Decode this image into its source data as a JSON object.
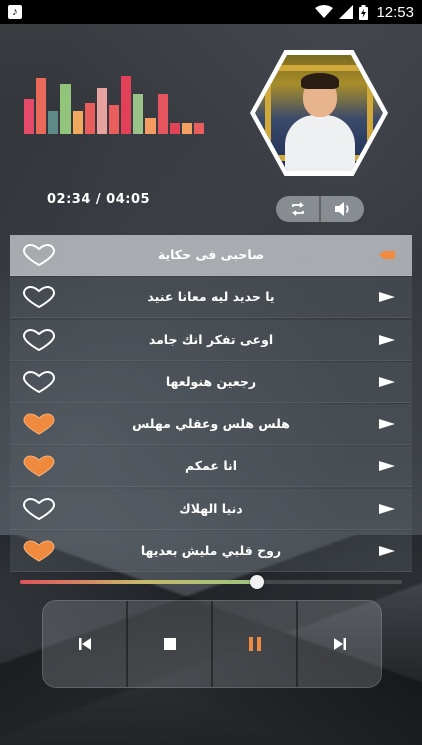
{
  "status_bar": {
    "time": "12:53",
    "icons": [
      "music-note-icon",
      "wifi-icon",
      "signal-icon",
      "battery-icon"
    ]
  },
  "equalizer": {
    "levels": [
      0.58,
      0.94,
      0.38,
      0.84,
      0.38,
      0.51,
      0.76,
      0.48,
      0.96,
      0.66,
      0.26,
      0.66,
      0.18,
      0.18,
      0.18
    ],
    "colors": [
      "#e64b6a",
      "#e96a5a",
      "#5e8a88",
      "#93c47b",
      "#f1a95e",
      "#e95d5d",
      "#e7a3a0",
      "#e95d5d",
      "#e23f59",
      "#9ac38a",
      "#f39b61",
      "#e55560",
      "#e04456",
      "#f3a163",
      "#e95d5d"
    ]
  },
  "player": {
    "time_display": "02:34 / 04:05",
    "progress": 0.62,
    "repeat_icon": "repeat-icon",
    "volume_icon": "volume-icon"
  },
  "playlist": [
    {
      "title": "صاحبى فى حكاية",
      "favorite": false,
      "active": true
    },
    {
      "title": "يا حديد ليه معانا عنيد",
      "favorite": false,
      "active": false
    },
    {
      "title": "اوعى تفكر انك جامد",
      "favorite": false,
      "active": false
    },
    {
      "title": "رجعين هنولعها",
      "favorite": false,
      "active": false
    },
    {
      "title": "هلس هلس وعقلي مهلس",
      "favorite": true,
      "active": false
    },
    {
      "title": "انا عمكم",
      "favorite": true,
      "active": false
    },
    {
      "title": "دنيا الهلاك",
      "favorite": false,
      "active": false
    },
    {
      "title": "روح قلبي مليش بعديها",
      "favorite": true,
      "active": false
    }
  ],
  "transport": {
    "buttons": [
      "previous-icon",
      "stop-icon",
      "pause-icon",
      "next-icon"
    ]
  },
  "colors": {
    "accent": "#f08a3e",
    "heart_filled": "#f08a3e",
    "active_row": "#cdd2d6"
  }
}
